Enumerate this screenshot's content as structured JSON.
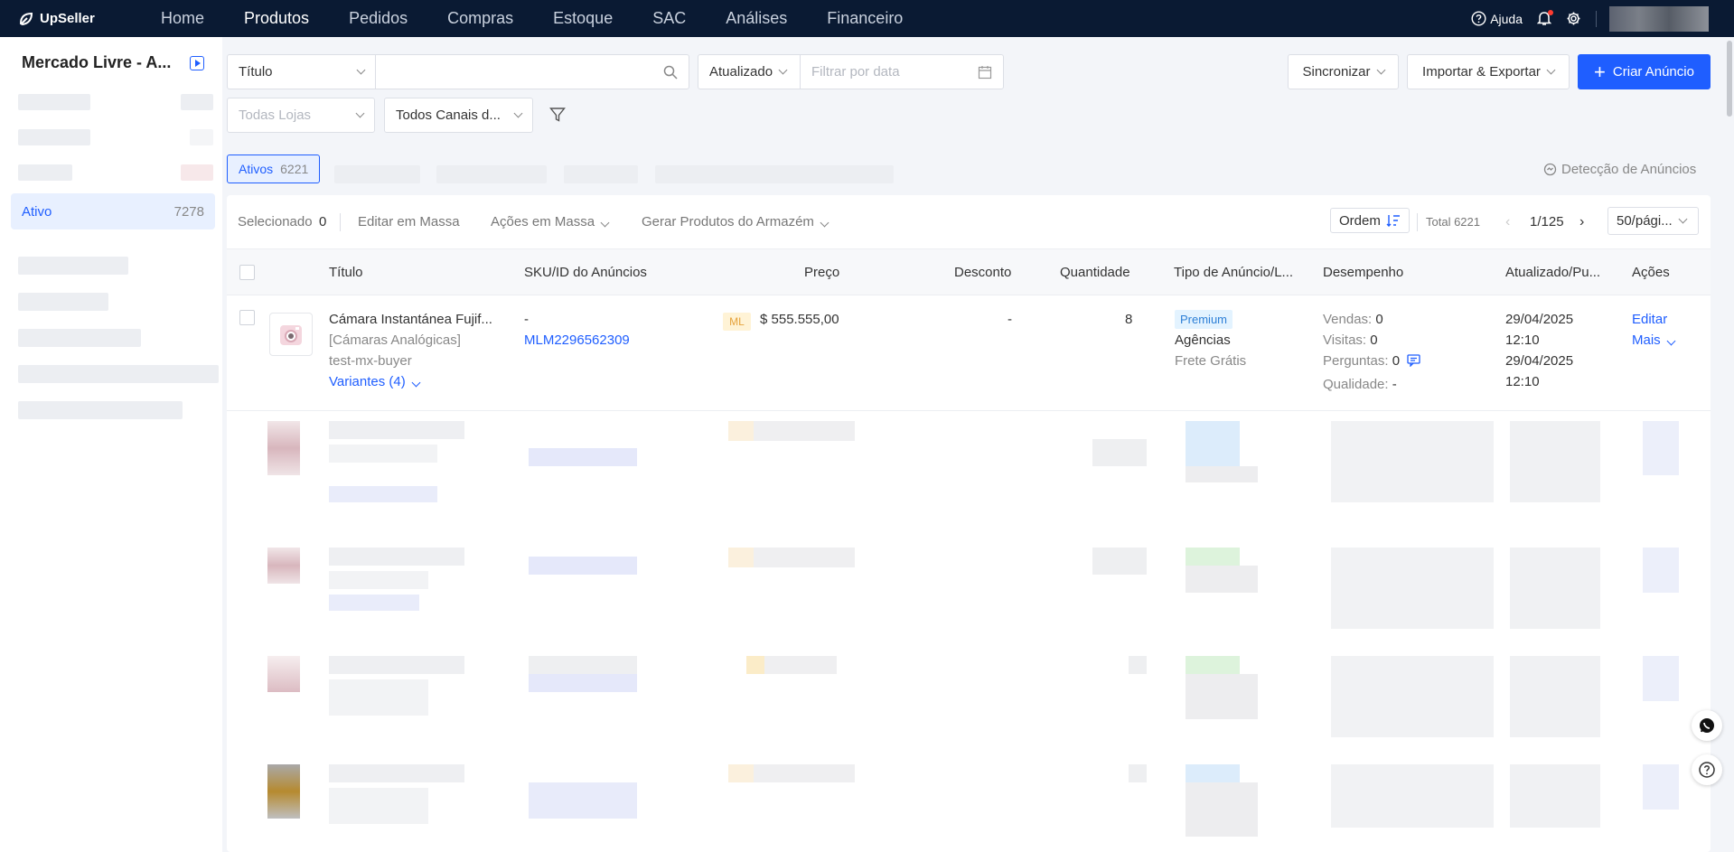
{
  "brand": "UpSeller",
  "nav": {
    "items": [
      "Home",
      "Produtos",
      "Pedidos",
      "Compras",
      "Estoque",
      "SAC",
      "Análises",
      "Financeiro"
    ],
    "help": "Ajuda"
  },
  "sidebar": {
    "store_title": "Mercado Livre - A...",
    "active_item": {
      "label": "Ativo",
      "count": "7278"
    }
  },
  "filters": {
    "field_select": "Título",
    "date_select": "Atualizado",
    "date_placeholder": "Filtrar por data",
    "store_placeholder": "Todas Lojas",
    "channels": "Todos Canais d...",
    "sync_label": "Sincronizar",
    "import_export_label": "Importar & Exportar",
    "create_label": "Criar Anúncio"
  },
  "tabs": {
    "active_label": "Ativos",
    "active_count": "6221",
    "detection": "Detecção de Anúncios"
  },
  "toolbar": {
    "selected_label": "Selecionado",
    "selected_count": "0",
    "bulk_edit": "Editar em Massa",
    "bulk_actions": "Ações em Massa",
    "generate": "Gerar Produtos do Armazém",
    "order": "Ordem",
    "total": "Total 6221",
    "page": "1/125",
    "per_page": "50/pági..."
  },
  "columns": {
    "title": "Título",
    "sku": "SKU/ID do Anúncios",
    "price": "Preço",
    "discount": "Desconto",
    "quantity": "Quantidade",
    "type": "Tipo de Anúncio/L...",
    "performance": "Desempenho",
    "updated": "Atualizado/Pu...",
    "actions": "Ações"
  },
  "row": {
    "title": "Cámara Instantánea Fujif...",
    "category": "[Cámaras Analógicas]",
    "seller": "test-mx-buyer",
    "variants": "Variantes (4)",
    "sku": "-",
    "listing_id": "MLM2296562309",
    "price_tag": "ML",
    "price": "$ 555.555,00",
    "discount": "-",
    "quantity": "8",
    "badge": "Premium",
    "agency": "Agências",
    "shipping": "Frete Grátis",
    "sales_label": "Vendas:",
    "sales": "0",
    "visits_label": "Visitas:",
    "visits": "0",
    "questions_label": "Perguntas:",
    "questions": "0",
    "quality_label": "Qualidade:",
    "quality": "-",
    "updated_date": "29/04/2025",
    "updated_time": "12:10",
    "published_date": "29/04/2025",
    "published_time": "12:10",
    "edit": "Editar",
    "more": "Mais"
  }
}
